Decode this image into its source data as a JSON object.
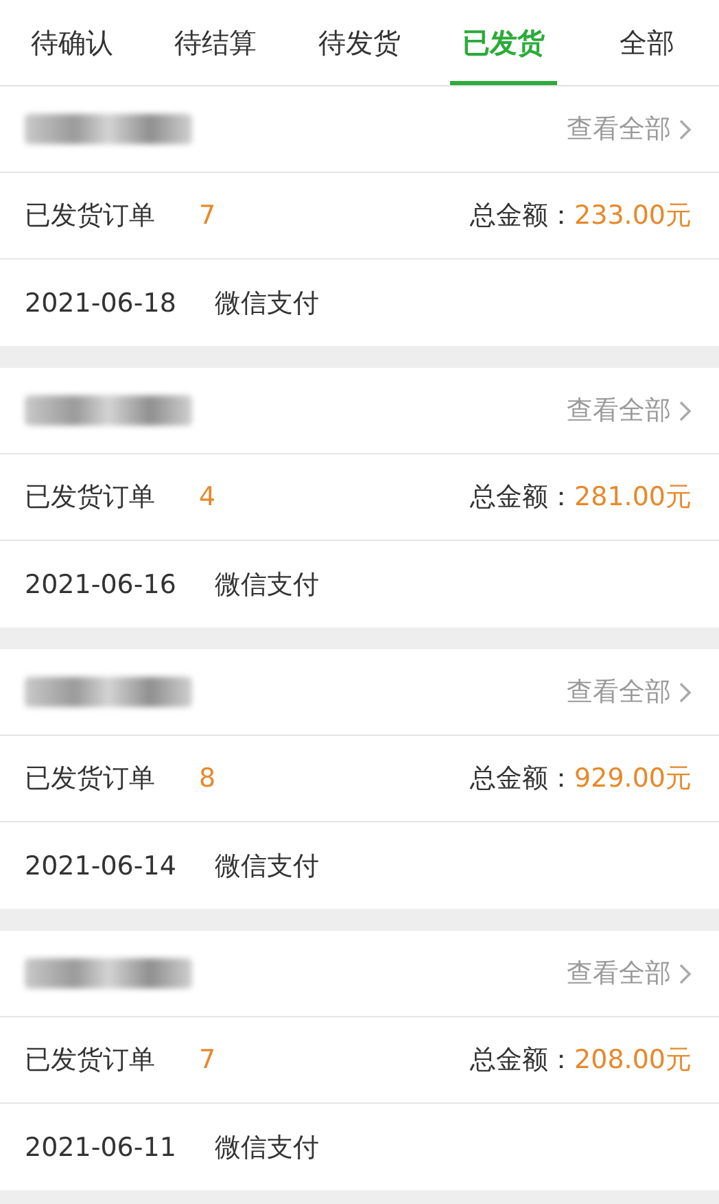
{
  "tabs": [
    {
      "label": "待确认",
      "selected": false
    },
    {
      "label": "待结算",
      "selected": false
    },
    {
      "label": "待发货",
      "selected": false
    },
    {
      "label": "已发货",
      "selected": true
    },
    {
      "label": "全部",
      "selected": false
    }
  ],
  "orders": [
    {
      "view_all": "查看全部",
      "status_label": "已发货订单",
      "count": "7",
      "total_label": "总金额：",
      "total": "233.00元",
      "date": "2021-06-18",
      "payment": "微信支付"
    },
    {
      "view_all": "查看全部",
      "status_label": "已发货订单",
      "count": "4",
      "total_label": "总金额：",
      "total": "281.00元",
      "date": "2021-06-16",
      "payment": "微信支付"
    },
    {
      "view_all": "查看全部",
      "status_label": "已发货订单",
      "count": "8",
      "total_label": "总金额：",
      "total": "929.00元",
      "date": "2021-06-14",
      "payment": "微信支付"
    },
    {
      "view_all": "查看全部",
      "status_label": "已发货订单",
      "count": "7",
      "total_label": "总金额：",
      "total": "208.00元",
      "date": "2021-06-11",
      "payment": "微信支付"
    }
  ]
}
